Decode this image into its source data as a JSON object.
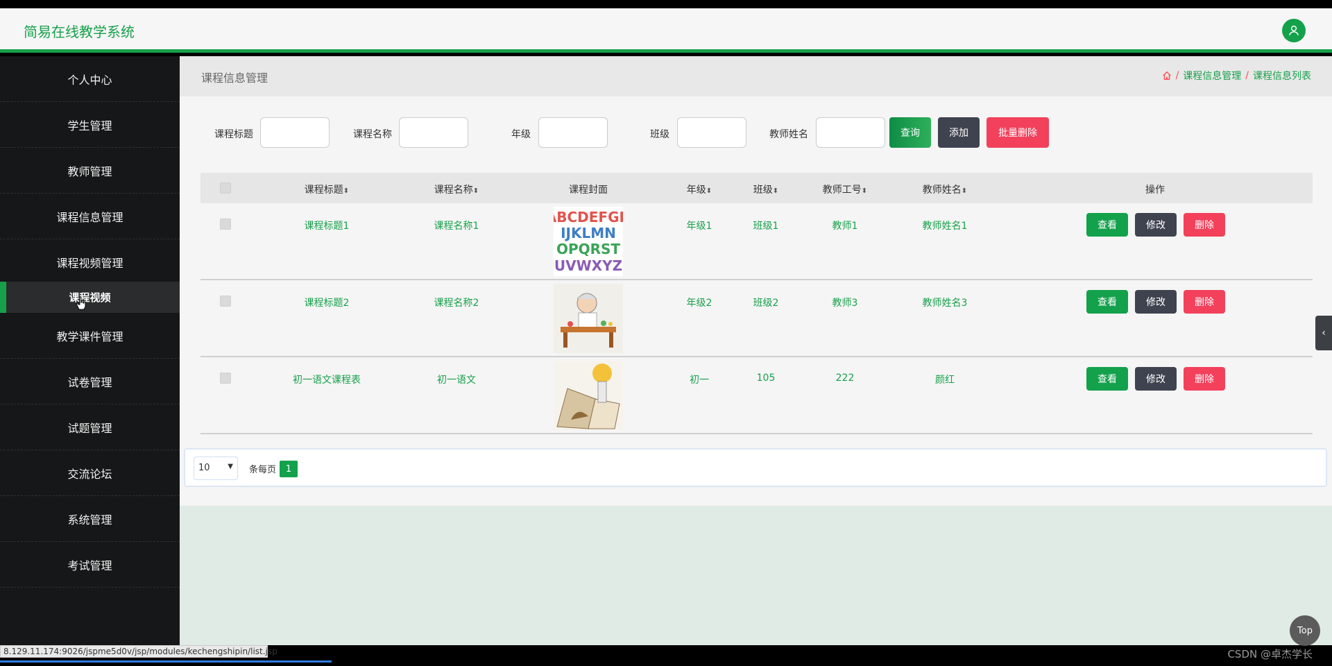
{
  "header": {
    "brand": "简易在线教学系统",
    "user_icon": "user-icon"
  },
  "sidebar": {
    "items": [
      {
        "label": "个人中心"
      },
      {
        "label": "学生管理"
      },
      {
        "label": "教师管理"
      },
      {
        "label": "课程信息管理"
      },
      {
        "label": "课程视频管理"
      },
      {
        "label": "教学课件管理"
      },
      {
        "label": "试卷管理"
      },
      {
        "label": "试题管理"
      },
      {
        "label": "交流论坛"
      },
      {
        "label": "系统管理"
      },
      {
        "label": "考试管理"
      }
    ],
    "active_sub": "课程视频"
  },
  "breadcrumb": {
    "page_title": "课程信息管理",
    "home_icon": "home-icon",
    "crumb1": "课程信息管理",
    "crumb2": "课程信息列表",
    "sep": "/"
  },
  "search": {
    "labels": {
      "course_title": "课程标题",
      "course_name": "课程名称",
      "grade": "年级",
      "class": "班级",
      "teacher_name": "教师姓名"
    },
    "buttons": {
      "query": "查询",
      "add": "添加",
      "batch_delete": "批量删除"
    }
  },
  "table": {
    "headers": {
      "course_title": "课程标题",
      "course_name": "课程名称",
      "cover": "课程封面",
      "grade": "年级",
      "class": "班级",
      "teacher_no": "教师工号",
      "teacher_name": "教师姓名",
      "actions": "操作"
    },
    "sort_icon": "⬍",
    "rows": [
      {
        "course_title": "课程标题1",
        "course_name": "课程名称1",
        "grade": "年级1",
        "class": "班级1",
        "teacher_no": "教师1",
        "teacher_name": "教师姓名1"
      },
      {
        "course_title": "课程标题2",
        "course_name": "课程名称2",
        "grade": "年级2",
        "class": "班级2",
        "teacher_no": "教师3",
        "teacher_name": "教师姓名3"
      },
      {
        "course_title": "初一语文课程表",
        "course_name": "初一语文",
        "grade": "初一",
        "class": "105",
        "teacher_no": "222",
        "teacher_name": "颜红"
      }
    ],
    "row_buttons": {
      "view": "查看",
      "edit": "修改",
      "delete": "删除"
    }
  },
  "pager": {
    "page_size": "10",
    "per_page_label": "条每页",
    "current_page": "1"
  },
  "floating": {
    "top_label": "Top",
    "toggle_icon": "‹"
  },
  "statusbar": {
    "url": "8.129.11.174:9026/jspme5d0v/jsp/modules/kechengshipin/list.jsp"
  },
  "watermark": "CSDN @卓杰学长",
  "colors": {
    "accent": "#17a04a",
    "dark": "#161718",
    "danger": "#f3405b",
    "neutral_button": "#3f4350"
  }
}
